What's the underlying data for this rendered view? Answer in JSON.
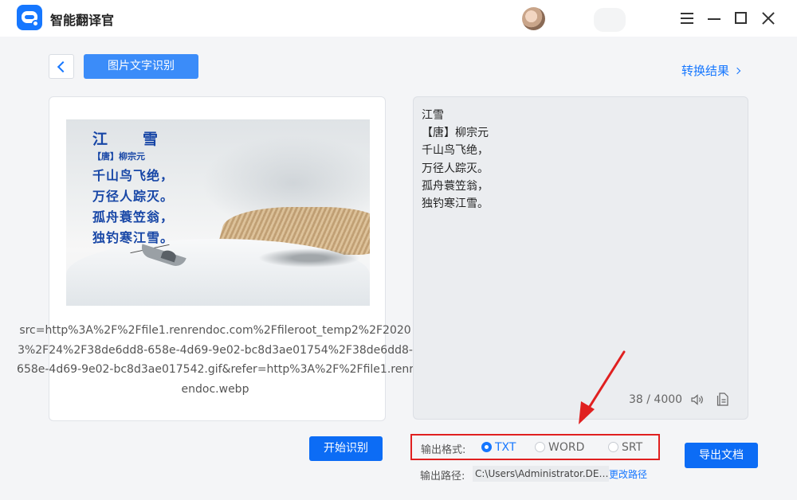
{
  "app": {
    "title": "智能翻译官"
  },
  "header": {
    "page_title": "图片文字识别",
    "result_link": "转换结果"
  },
  "image_panel": {
    "poem": {
      "title": "江　　雪",
      "author": "【唐】柳宗元",
      "lines": [
        "千山鸟飞绝，",
        "万径人踪灭。",
        "孤舟蓑笠翁，",
        "独钓寒江雪。"
      ]
    },
    "src_text": "src=http%3A%2F%2Ffile1.renrendoc.com%2Ffileroot_temp2%2F20203%2F24%2F38de6dd8-658e-4d69-9e02-bc8d3ae01754%2F38de6dd8-658e-4d69-9e02-bc8d3ae017542.gif&refer=http%3A%2F%2Ffile1.renrendoc.webp"
  },
  "result_panel": {
    "lines": [
      "江雪",
      "【唐】柳宗元",
      "千山鸟飞绝，",
      "万径人踪灭。",
      "孤舟蓑笠翁，",
      "独钓寒江雪。"
    ],
    "char_count": "38 / 4000"
  },
  "controls": {
    "start_button": "开始识别",
    "format_label": "输出格式:",
    "formats": [
      "TXT",
      "WORD",
      "SRT"
    ],
    "selected_format": "TXT",
    "export_button": "导出文档",
    "path_label": "输出路径:",
    "path_value": "C:\\Users\\Administrator.DESKTOP",
    "change_path": "更改路径"
  },
  "colors": {
    "accent": "#1677ff",
    "button": "#0c6cf5",
    "highlight": "#e02020"
  }
}
